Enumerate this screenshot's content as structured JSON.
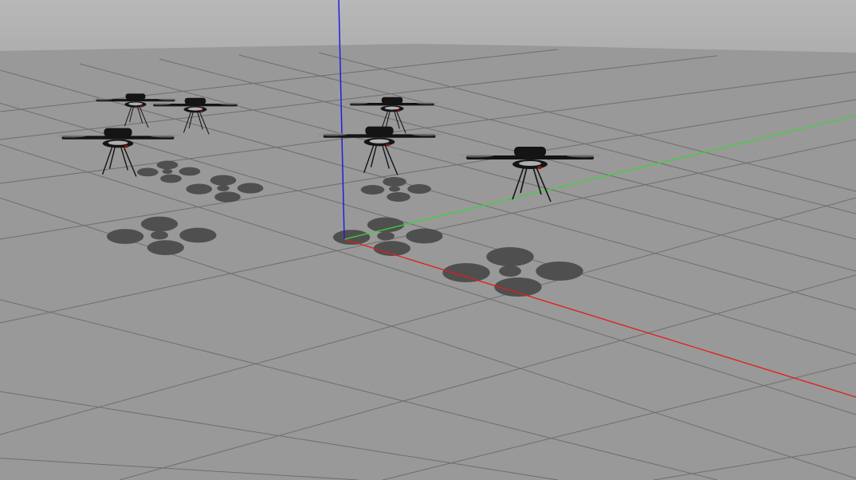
{
  "scene": {
    "type": "3d-simulation-viewport",
    "objects": [
      "quadrotor",
      "quadrotor",
      "quadrotor",
      "quadrotor",
      "quadrotor",
      "quadrotor"
    ]
  },
  "colors": {
    "sky": "#b4b4b4",
    "ground": "#999999",
    "grid_line": "#6e6e6e",
    "x_axis": "#e41a1a",
    "y_axis": "#3cd23c",
    "z_axis": "#1e1ee0",
    "drone": "#141414",
    "drone_light": "#8a1010",
    "shadow": "#4f4f4f"
  },
  "axes": {
    "x": "x-axis",
    "y": "y-axis",
    "z": "z-axis"
  }
}
